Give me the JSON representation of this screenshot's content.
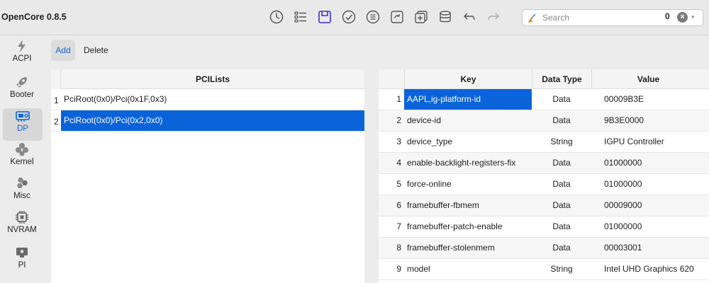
{
  "app": {
    "title": "OpenCore 0.8.5"
  },
  "toolbar": {
    "icons": [
      "history-icon",
      "list-icon",
      "save-icon",
      "check-icon",
      "format-list-icon",
      "compare-icon",
      "add-square-icon",
      "database-icon",
      "undo-icon",
      "redo-icon"
    ]
  },
  "search": {
    "placeholder": "Search",
    "value": "",
    "count": "0",
    "clear_symbol": "×",
    "dropdown_symbol": "▾"
  },
  "sidebar": {
    "items": [
      {
        "label": "ACPI",
        "icon": "acpi-bolt-icon"
      },
      {
        "label": "Booter",
        "icon": "booter-rocket-icon"
      },
      {
        "label": "DP",
        "icon": "dp-gpu-icon",
        "selected": true
      },
      {
        "label": "Kernel",
        "icon": "kernel-icon"
      },
      {
        "label": "Misc",
        "icon": "misc-hexagons-icon"
      },
      {
        "label": "NVRAM",
        "icon": "nvram-chip-icon"
      },
      {
        "label": "PI",
        "icon": "pi-apple-icon"
      }
    ]
  },
  "actions": {
    "add_label": "Add",
    "delete_label": "Delete"
  },
  "pci_table": {
    "header": "PCILists",
    "rows": [
      {
        "num": "1",
        "path": "PciRoot(0x0)/Pci(0x1F,0x3)"
      },
      {
        "num": "2",
        "path": "PciRoot(0x0)/Pci(0x2,0x0)",
        "selected": true
      }
    ]
  },
  "key_table": {
    "headers": {
      "key": "Key",
      "type": "Data Type",
      "value": "Value"
    },
    "rows": [
      {
        "num": "1",
        "key": "AAPL,ig-platform-id",
        "type": "Data",
        "value": "00009B3E",
        "selected": true
      },
      {
        "num": "2",
        "key": "device-id",
        "type": "Data",
        "value": "9B3E0000"
      },
      {
        "num": "3",
        "key": "device_type",
        "type": "String",
        "value": "IGPU Controller"
      },
      {
        "num": "4",
        "key": "enable-backlight-registers-fix",
        "type": "Data",
        "value": "01000000"
      },
      {
        "num": "5",
        "key": "force-online",
        "type": "Data",
        "value": "01000000"
      },
      {
        "num": "6",
        "key": "framebuffer-fbmem",
        "type": "Data",
        "value": "00009000"
      },
      {
        "num": "7",
        "key": "framebuffer-patch-enable",
        "type": "Data",
        "value": "01000000"
      },
      {
        "num": "8",
        "key": "framebuffer-stolenmem",
        "type": "Data",
        "value": "00003001"
      },
      {
        "num": "9",
        "key": "model",
        "type": "String",
        "value": "Intel UHD Graphics 620"
      }
    ]
  },
  "colors": {
    "accent": "#0a63d9",
    "selected_label": "#1466d4"
  }
}
